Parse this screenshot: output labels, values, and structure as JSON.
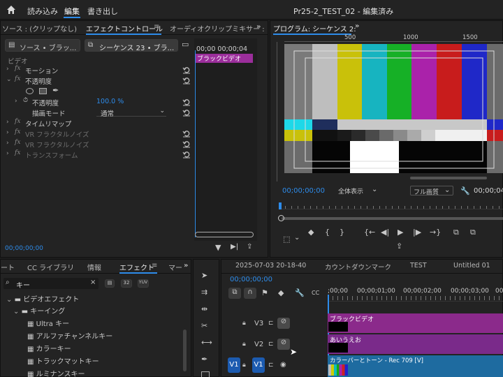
{
  "menu": {
    "import": "読み込み",
    "edit": "編集",
    "export": "書き出し"
  },
  "app_title": "Pr25-2_TEST_02 - 編集済み",
  "source_panel": {
    "tab_source": "ソース : (クリップなし)",
    "tab_effect_controls": "エフェクトコントロール",
    "tab_audio_mixer": "オーディオクリップミキサー :",
    "clip_selector": "ソース • ブラッ...",
    "sequence_selector": "シーケンス 23 • ブラ...",
    "timecode_top": "00;00  00;00;04",
    "section_video": "ビデオ",
    "effects": [
      {
        "name": "モーション",
        "kind": "fx"
      },
      {
        "name": "不透明度",
        "kind": "fx"
      },
      {
        "name": "不透明度",
        "kind": "param",
        "value": "100.0 %"
      },
      {
        "name": "描画モード",
        "kind": "param",
        "value": "通常"
      },
      {
        "name": "タイムリマップ",
        "kind": "fx"
      },
      {
        "name": "VR フラクタルノイズ",
        "kind": "fx"
      },
      {
        "name": "VR フラクタルノイズ",
        "kind": "fx"
      },
      {
        "name": "トランスフォーム",
        "kind": "fx"
      }
    ],
    "clip_name": "ブラックビデオ",
    "timecode_bottom": "00;00;00;00"
  },
  "program_panel": {
    "tab_label": "プログラム: シーケンス 2:",
    "ruler": [
      "500",
      "1000",
      "1500"
    ],
    "timecode": "00;00;00;00",
    "fit_label": "全体表示",
    "quality_label": "フル画質",
    "duration": "00;00;04"
  },
  "effects_panel": {
    "tabs": [
      "ート",
      "CC ライブラリ",
      "情報",
      "エフェクト",
      "マー"
    ],
    "search_value": "キー",
    "badges": [
      "32",
      "YUV"
    ],
    "tree": [
      {
        "label": "ビデオエフェクト",
        "level": 0
      },
      {
        "label": "キーイング",
        "level": 1
      },
      {
        "label": "Ultra キー",
        "level": 2
      },
      {
        "label": "アルファチャンネルキー",
        "level": 2
      },
      {
        "label": "カラーキー",
        "level": 2
      },
      {
        "label": "トラックマットキー",
        "level": 2
      },
      {
        "label": "ルミナンスキー",
        "level": 2
      }
    ]
  },
  "timeline": {
    "tabs": [
      "2025-07-03 20-18-40",
      "カウントダウンマーク",
      "TEST",
      "Untitled 01"
    ],
    "timecode": "00;00;00;00",
    "ruler": [
      ";00;00",
      "00;00;01;00",
      "00;00;02;00",
      "00;00;03;00",
      "00;00"
    ],
    "tracks": [
      {
        "label": "V3",
        "clip": "ブラックビデオ"
      },
      {
        "label": "V2",
        "clip": "あいうえお"
      },
      {
        "label": "V1",
        "clip": "カラーバーとトーン - Rec 709 [V]"
      }
    ],
    "source_patch": "V1"
  }
}
